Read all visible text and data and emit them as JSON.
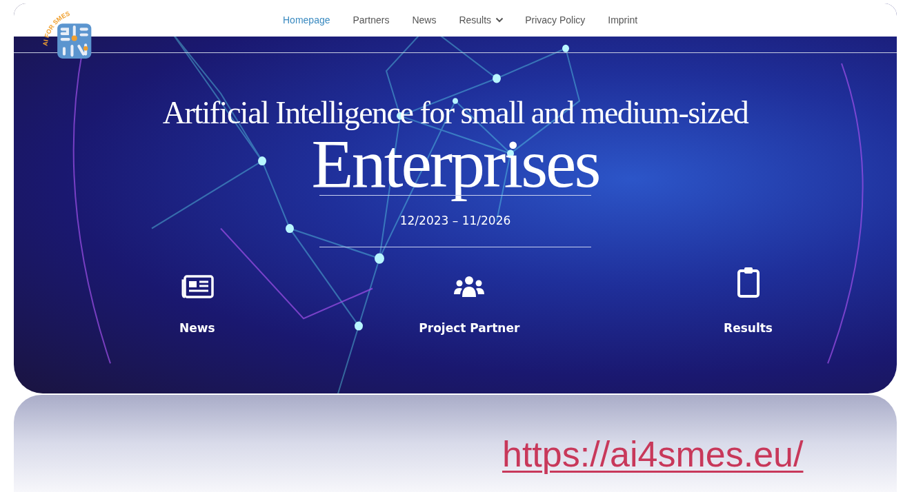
{
  "logo": {
    "text": "AI FOR SMES"
  },
  "nav": [
    {
      "label": "Homepage",
      "selected": true,
      "dropdown": false
    },
    {
      "label": "Partners",
      "selected": false,
      "dropdown": false
    },
    {
      "label": "News",
      "selected": false,
      "dropdown": false
    },
    {
      "label": "Results",
      "selected": false,
      "dropdown": true
    },
    {
      "label": "Privacy Policy",
      "selected": false,
      "dropdown": false
    },
    {
      "label": "Imprint",
      "selected": false,
      "dropdown": false
    }
  ],
  "hero": {
    "title": "Artificial Intelligence for small and medium-sized",
    "title_main": "Enterprises",
    "dates": "12/2023 – 11/2026",
    "features": [
      {
        "kind": "news",
        "label": "News"
      },
      {
        "kind": "partners",
        "label": "Project Partner"
      },
      {
        "kind": "results",
        "label": "Results"
      }
    ]
  },
  "link": "https://ai4smes.eu/"
}
